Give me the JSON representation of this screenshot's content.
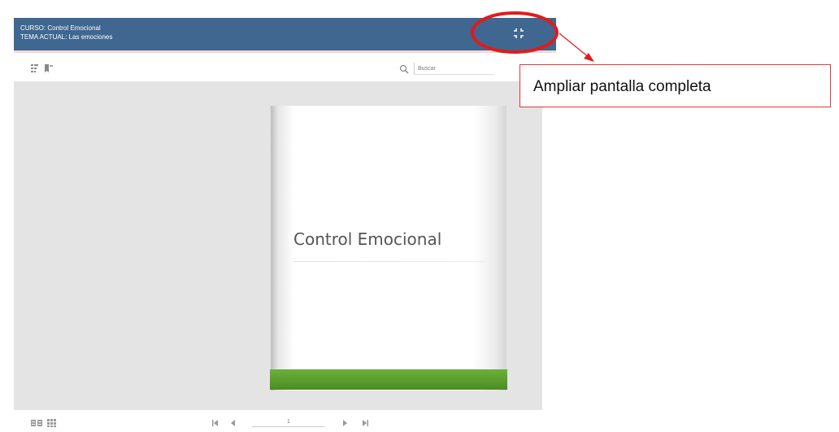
{
  "course": {
    "line1": "CURSO: Control Emocional",
    "line2": "TEMA ACTUAL: Las emociones"
  },
  "header": {
    "fullscreen_icon": "expand-icon"
  },
  "toolbar": {
    "icons": [
      "table-of-contents-icon",
      "bookmark-icon"
    ],
    "search_icon": "search-icon",
    "search_placeholder": "Buscar"
  },
  "page": {
    "title": "Control Emocional",
    "band_color": "#5fa531"
  },
  "pager": {
    "current_page": "1",
    "icons": [
      "two-page-view-icon",
      "grid-view-icon",
      "first-page-icon",
      "previous-page-icon",
      "next-page-icon",
      "last-page-icon"
    ]
  },
  "callout": {
    "text": "Ampliar pantalla completa",
    "color": "#e01b1b"
  },
  "colors": {
    "header_bg": "#3f6790",
    "stage_bg": "#e4e4e4"
  }
}
